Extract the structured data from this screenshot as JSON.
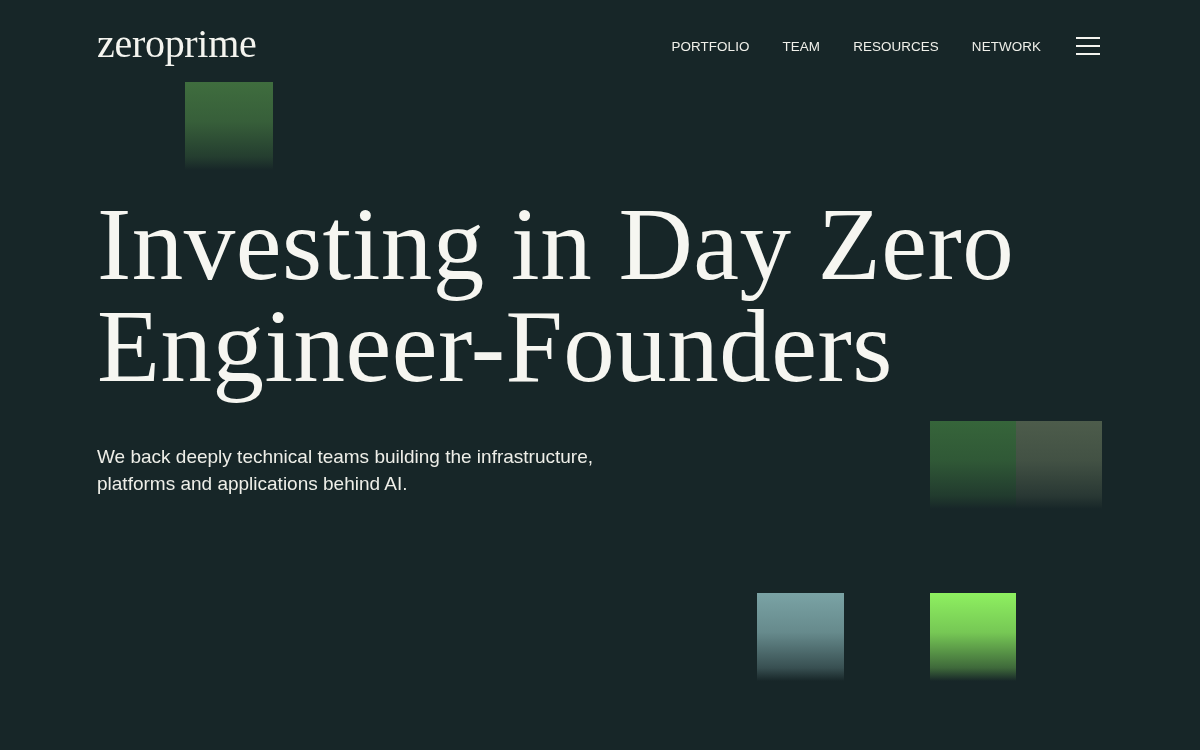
{
  "header": {
    "logo": "zeroprime",
    "nav": [
      {
        "label": "PORTFOLIO"
      },
      {
        "label": "TEAM"
      },
      {
        "label": "RESOURCES"
      },
      {
        "label": "NETWORK"
      }
    ]
  },
  "hero": {
    "headline": "Investing in Day Zero Engineer-Founders",
    "subtitle": "We back deeply technical teams building the infrastructure, platforms and applications behind AI."
  }
}
